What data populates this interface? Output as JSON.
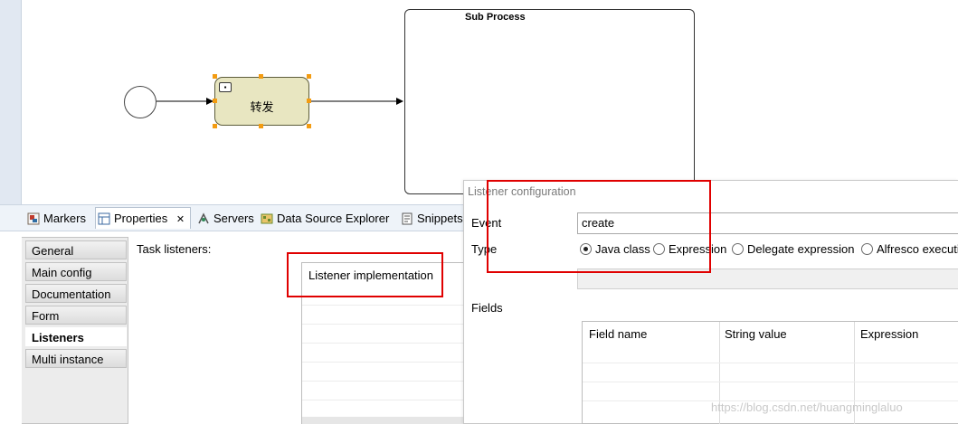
{
  "diagram": {
    "task_label": "转发",
    "subprocess_title": "Sub Process"
  },
  "tabs": [
    {
      "label": "Markers"
    },
    {
      "label": "Properties"
    },
    {
      "label": "Servers"
    },
    {
      "label": "Data Source Explorer"
    },
    {
      "label": "Snippets"
    }
  ],
  "properties": {
    "side_items": [
      {
        "label": "General"
      },
      {
        "label": "Main config"
      },
      {
        "label": "Documentation"
      },
      {
        "label": "Form"
      },
      {
        "label": "Listeners"
      },
      {
        "label": "Multi instance"
      }
    ],
    "active_item": "Listeners",
    "task_listeners_label": "Task listeners:",
    "listener_column": "Listener implementation"
  },
  "dialog": {
    "title": "Listener configuration",
    "event_label": "Event",
    "event_value": "create",
    "type_label": "Type",
    "type_options": [
      {
        "label": "Java class",
        "checked": true
      },
      {
        "label": "Expression",
        "checked": false
      },
      {
        "label": "Delegate expression",
        "checked": false
      },
      {
        "label": "Alfresco executi",
        "checked": false
      }
    ],
    "fields_label": "Fields",
    "field_columns": [
      {
        "label": "Field name"
      },
      {
        "label": "String value"
      },
      {
        "label": "Expression"
      }
    ]
  },
  "watermark": "https://blog.csdn.net/huangminglaluo",
  "colors": {
    "annotation": "#e00000",
    "task_fill": "#e8e6c1",
    "handle": "#f39c12"
  }
}
